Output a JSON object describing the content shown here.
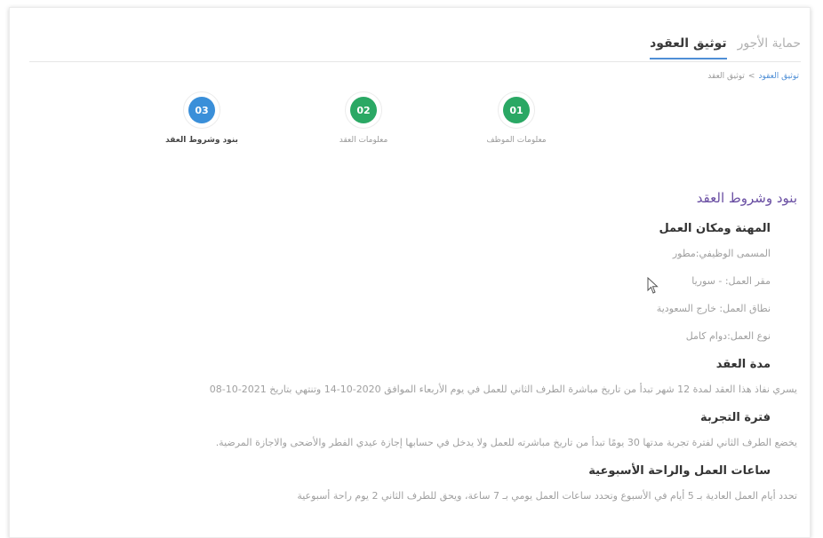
{
  "tabs": [
    {
      "label": "توثيق العقود",
      "active": true
    },
    {
      "label": "حماية الأجور",
      "active": false
    }
  ],
  "breadcrumb": {
    "link": "توثيق العقود",
    "separator": ">",
    "current": "توثيق العقد"
  },
  "steps": [
    {
      "number": "01",
      "label": "معلومات الموظف",
      "color": "#2aa864",
      "active": false
    },
    {
      "number": "02",
      "label": "معلومات العقد",
      "color": "#2aa864",
      "active": false
    },
    {
      "number": "03",
      "label": "بنود وشروط العقد",
      "color": "#3a8fd9",
      "active": true
    }
  ],
  "content": {
    "section_title": "بنود وشروط العقد",
    "job": {
      "heading": "المهنة ومكان العمل",
      "title_line": "المسمى الوظيفي:مطور",
      "location_line": "مقر العمل: - سوريا",
      "scope_line": "نطاق العمل: خارج السعودية",
      "type_line": "نوع العمل:دوام كامل"
    },
    "duration": {
      "heading": "مدة العقد",
      "text": "يسري نفاذ هذا العقد لمدة 12 شهر تبدأ من تاريخ مباشرة الطرف الثاني للعمل في يوم الأربعاء الموافق 2020-10-14 وتنتهي بتاريخ 2021-10-08"
    },
    "probation": {
      "heading": "فترة التجربة",
      "text": "يخضع الطرف الثاني لفترة تجربة مدتها 30 يومًا تبدأ من تاريخ مباشرته للعمل ولا يدخل في حسابها إجازة عيدي الفطر والأضحى والاجازة المرضية."
    },
    "hours": {
      "heading": "ساعات العمل والراحة الأسبوعية",
      "text": "تحدد أيام العمل العادية بـ 5 أيام في الأسبوع وتحدد ساعات العمل يومي بـ 7 ساعة، ويحق للطرف الثاني 2 يوم راحة أسبوعية"
    }
  }
}
